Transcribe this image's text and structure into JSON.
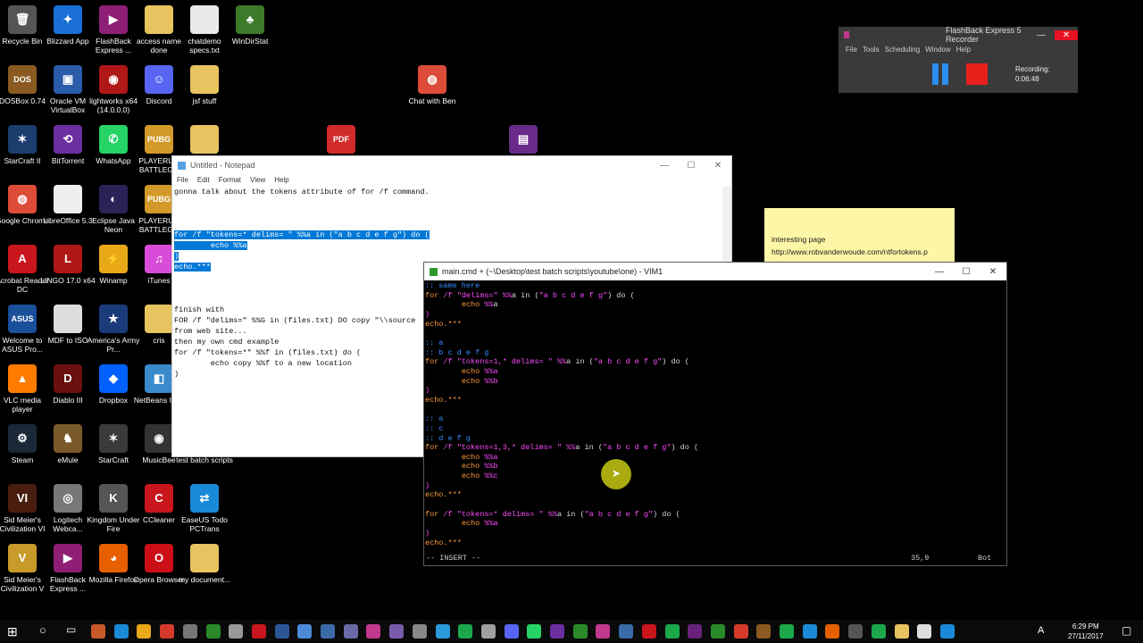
{
  "desktop": {
    "icons": [
      {
        "label": "Recycle Bin",
        "glyph": "🗑",
        "color": "#555"
      },
      {
        "label": "Blizzard App",
        "glyph": "✦",
        "color": "#1a6fd6"
      },
      {
        "label": "FlashBack Express ...",
        "glyph": "▶",
        "color": "#8e1f74"
      },
      {
        "label": "access name done",
        "glyph": "",
        "color": "#e8c460"
      },
      {
        "label": "chatdemo specs.txt",
        "glyph": "",
        "color": "#eaeaea"
      },
      {
        "label": "WinDirStat",
        "glyph": "♣",
        "color": "#3d7a2a"
      },
      {
        "label": "DOSBox 0.74",
        "glyph": "DOS",
        "color": "#8a5a20"
      },
      {
        "label": "Oracle VM VirtualBox",
        "glyph": "▣",
        "color": "#2a5caa"
      },
      {
        "label": "lightworks x64 (14.0.0.0)",
        "glyph": "◉",
        "color": "#b01818"
      },
      {
        "label": "Discord",
        "glyph": "☺",
        "color": "#5865f2"
      },
      {
        "label": "jsf stuff",
        "glyph": "",
        "color": "#e8c460"
      },
      {
        "label": "Chat with Ben",
        "glyph": "◍",
        "color": "#dd4b39"
      },
      {
        "label": "StarCraft II",
        "glyph": "✶",
        "color": "#1c3e6e"
      },
      {
        "label": "BitTorrent",
        "glyph": "⟲",
        "color": "#6b2fa0"
      },
      {
        "label": "WhatsApp",
        "glyph": "✆",
        "color": "#25d366"
      },
      {
        "label": "PLAYERUN BATTLEGR",
        "glyph": "PUBG",
        "color": "#d39a2a"
      },
      {
        "label": "",
        "glyph": "",
        "color": "#e8c460"
      },
      {
        "label": "",
        "glyph": "PDF",
        "color": "#d12a2a"
      },
      {
        "label": "",
        "glyph": "▤",
        "color": "#6a2a8a"
      },
      {
        "label": "Google Chrome",
        "glyph": "◍",
        "color": "#dd4b39"
      },
      {
        "label": "LibreOffice 5.3",
        "glyph": "",
        "color": "#eee"
      },
      {
        "label": "Eclipse Java Neon",
        "glyph": "◐",
        "color": "#2c2255"
      },
      {
        "label": "PLAYERUN BATTLEGR",
        "glyph": "PUBG",
        "color": "#d39a2a"
      },
      {
        "label": "Acrobat Reader DC",
        "glyph": "A",
        "color": "#c9161c"
      },
      {
        "label": "LINGO 17.0 x64",
        "glyph": "L",
        "color": "#b01818"
      },
      {
        "label": "Winamp",
        "glyph": "⚡",
        "color": "#e8a818"
      },
      {
        "label": "iTunes",
        "glyph": "♫",
        "color": "#d94cd9"
      },
      {
        "label": "Welcome to ASUS Pro...",
        "glyph": "ASUS",
        "color": "#1a4f9a"
      },
      {
        "label": "MDF to ISO",
        "glyph": "",
        "color": "#ddd"
      },
      {
        "label": "America's Army Pr...",
        "glyph": "★",
        "color": "#1b3a7a"
      },
      {
        "label": "cris",
        "glyph": "",
        "color": "#e8c460"
      },
      {
        "label": "VLC media player",
        "glyph": "▲",
        "color": "#ff7b00"
      },
      {
        "label": "Diablo III",
        "glyph": "D",
        "color": "#6a1010"
      },
      {
        "label": "Dropbox",
        "glyph": "◆",
        "color": "#0061fe"
      },
      {
        "label": "NetBeans I 8.2",
        "glyph": "◧",
        "color": "#3a8acc"
      },
      {
        "label": "Steam",
        "glyph": "⚙",
        "color": "#1b2838"
      },
      {
        "label": "eMule",
        "glyph": "♞",
        "color": "#7a5a2a"
      },
      {
        "label": "StarCraft",
        "glyph": "✶",
        "color": "#3a3a3a"
      },
      {
        "label": "MusicBee",
        "glyph": "◉",
        "color": "#333"
      },
      {
        "label": "test batch scripts",
        "glyph": "",
        "color": "#e8c460"
      },
      {
        "label": "Sid Meier's Civilization VI",
        "glyph": "VI",
        "color": "#4a1e0e"
      },
      {
        "label": "Logitech Webca...",
        "glyph": "◎",
        "color": "#777"
      },
      {
        "label": "Kingdom Under Fire",
        "glyph": "K",
        "color": "#555"
      },
      {
        "label": "CCleaner",
        "glyph": "C",
        "color": "#c9161c"
      },
      {
        "label": "EaseUS Todo PCTrans",
        "glyph": "⇄",
        "color": "#1a8ad8"
      },
      {
        "label": "Sid Meier's Civilization V",
        "glyph": "V",
        "color": "#c89a2a"
      },
      {
        "label": "FlashBack Express ...",
        "glyph": "▶",
        "color": "#8e1f74"
      },
      {
        "label": "Mozilla Firefox",
        "glyph": "◕",
        "color": "#e66000"
      },
      {
        "label": "Opera Browser",
        "glyph": "O",
        "color": "#cc0f16"
      },
      {
        "label": "my document...",
        "glyph": "",
        "color": "#e8c460"
      }
    ]
  },
  "recorder": {
    "title": "FlashBack Express 5 Recorder",
    "menu": [
      "File",
      "Tools",
      "Scheduling",
      "Window",
      "Help"
    ],
    "status_label": "Recording:",
    "elapsed": "0:06:48"
  },
  "sticky": {
    "line1": "interesting page",
    "line2": "http://www.robvanderwoude.com/ntfortokens.p"
  },
  "notepad": {
    "title": "Untitled - Notepad",
    "menu": [
      "File",
      "Edit",
      "Format",
      "View",
      "Help"
    ],
    "line1": "gonna talk about the tokens attribute of for /f command.",
    "sel1": "for /f \"tokens=* delims= \" %%a in (\"a b c d e f g\") do (",
    "sel2": "        echo %%a",
    "sel3": ")",
    "sel4": "echo.***",
    "tail1": "finish with",
    "tail2": "FOR /f \"delims=\" %%G in (files.txt) DO copy \"\\\\source",
    "tail3": "from web site...",
    "tail4": "then my own cmd example",
    "tail5": "for /f \"tokens=*\" %%f in (files.txt) do (",
    "tail6": "        echo copy %%f to a new location",
    "tail7": ")"
  },
  "vim": {
    "title": "main.cmd + (~\\Desktop\\test batch scripts\\youtube\\one) - VIM1",
    "mode": "-- INSERT --",
    "position": "35,9",
    "scroll": "Bot"
  },
  "taskbar": {
    "time": "6:29 PM",
    "date": "27/11/2017",
    "lang": "A"
  }
}
